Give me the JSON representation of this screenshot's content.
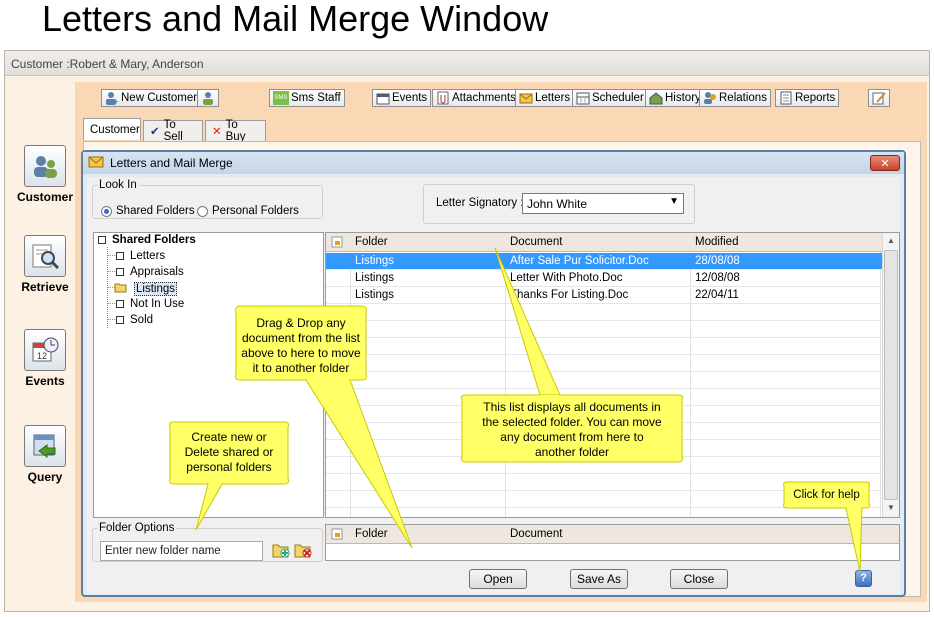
{
  "page_title": "Letters and Mail Merge Window",
  "window": {
    "title": "Customer :Robert & Mary, Anderson"
  },
  "sidebar": {
    "items": [
      {
        "label": "Customer",
        "icon": "customer-icon"
      },
      {
        "label": "Retrieve",
        "icon": "magnifier-icon"
      },
      {
        "label": "Events",
        "icon": "calendar-clock-icon"
      },
      {
        "label": "Query",
        "icon": "database-icon"
      }
    ]
  },
  "toolbar": {
    "new_customer": "New Customer",
    "sms_staff": "Sms Staff",
    "sms_badge": "SMS",
    "events": "Events",
    "attachments": "Attachments",
    "letters": "Letters",
    "scheduler": "Scheduler",
    "history": "History",
    "relations": "Relations",
    "reports": "Reports"
  },
  "tabs": [
    {
      "label": "Customer",
      "active": true
    },
    {
      "label": "To Sell",
      "icon": "check-icon"
    },
    {
      "label": "To Buy",
      "icon": "x-icon"
    }
  ],
  "dialog": {
    "title": "Letters and Mail Merge",
    "close_glyph": "✕",
    "look_in": {
      "legend": "Look In",
      "options": [
        "Shared Folders",
        "Personal Folders"
      ],
      "selected": "Shared Folders"
    },
    "signatory": {
      "label": "Letter Signatory :",
      "value": "John White"
    },
    "tree": {
      "root": "Shared Folders",
      "children": [
        "Letters",
        "Appraisals",
        "Listings",
        "Not In Use",
        "Sold"
      ],
      "selected": "Listings"
    },
    "grid": {
      "columns": [
        "Folder",
        "Document",
        "Modified"
      ],
      "rows": [
        {
          "folder": "Listings",
          "document": "After Sale Pur Solicitor.Doc",
          "modified": "28/08/08",
          "selected": true
        },
        {
          "folder": "Listings",
          "document": "Letter With Photo.Doc",
          "modified": "12/08/08"
        },
        {
          "folder": "Listings",
          "document": "Thanks For Listing.Doc",
          "modified": "22/04/11"
        }
      ]
    },
    "grid2": {
      "columns": [
        "Folder",
        "Document"
      ]
    },
    "folder_options": {
      "legend": "Folder Options",
      "placeholder": "Enter new folder name"
    },
    "buttons": {
      "open": "Open",
      "save_as": "Save As",
      "close": "Close",
      "help": "?"
    }
  },
  "callouts": {
    "drag_drop": [
      "Drag & Drop any",
      "document from the list",
      "above to here to move",
      "it to another folder"
    ],
    "list_info": [
      "This list displays all documents in",
      "the selected folder. You can move",
      "any document from here to",
      "another folder"
    ],
    "create_folder": [
      "Create new or",
      "Delete shared or",
      "personal folders"
    ],
    "help": [
      "Click for help"
    ]
  },
  "colors": {
    "callout": "#ffff66",
    "selection": "#3399ff",
    "dialog_border": "#5d7ea4",
    "outer_bg": "#fbd8b5"
  }
}
